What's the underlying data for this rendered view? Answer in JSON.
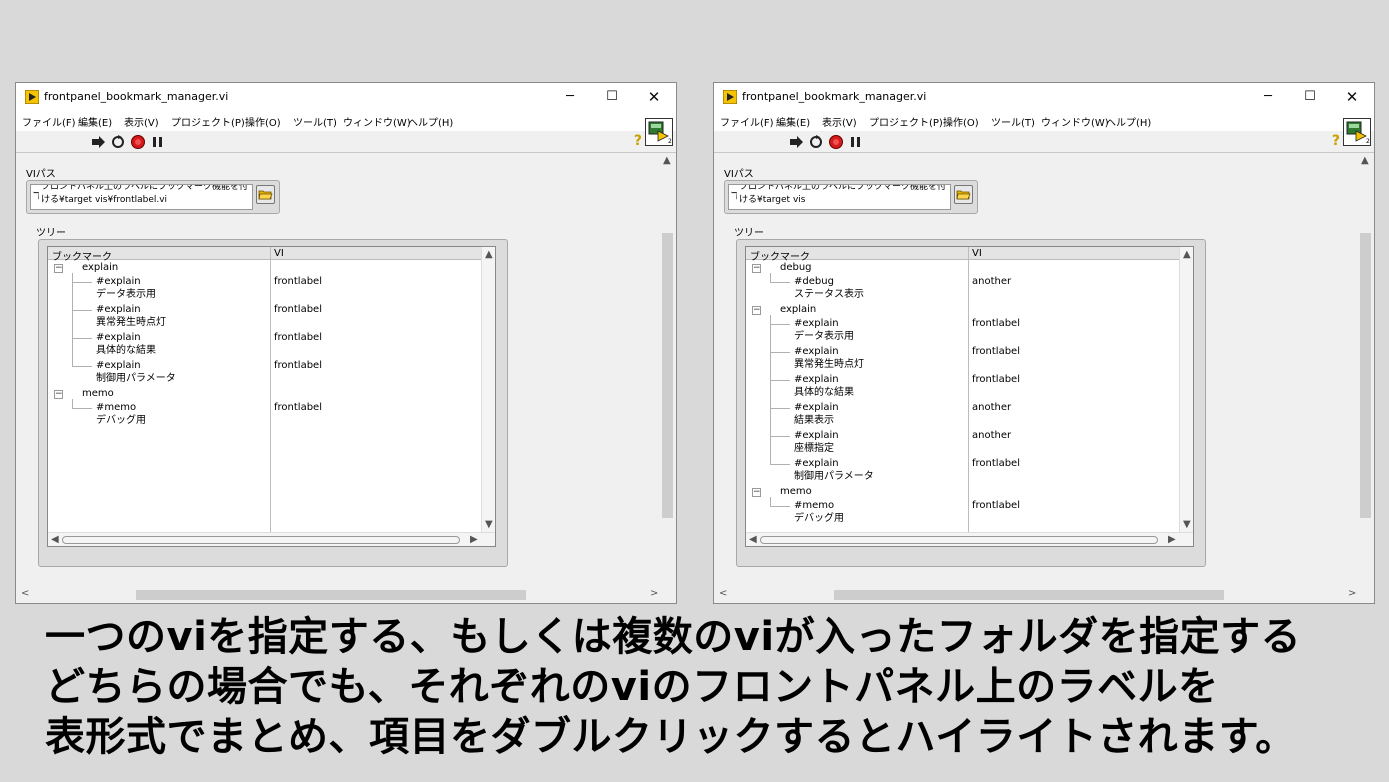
{
  "window_title": "frontpanel_bookmark_manager.vi",
  "window_controls": {
    "minimize": "─",
    "maximize": "☐",
    "close": "✕"
  },
  "menu": [
    "ファイル(F)",
    "編集(E)",
    "表示(V)",
    "プロジェクト(P)",
    "操作(O)",
    "ツール(T)",
    "ウィンドウ(W)",
    "ヘルプ(H)"
  ],
  "help_glyph": "?",
  "connector_badge": "2",
  "labels": {
    "vi_path": "VIパス",
    "tree": "ツリー",
    "stop_button": "停止ボタン",
    "stop": "停止"
  },
  "tree_columns": {
    "bookmark": "ブックマーク",
    "vi": "VI"
  },
  "colors": {
    "stop_red": "#ee1111",
    "labview_yellow": "#f5c400",
    "background": "#d9d9d9"
  },
  "left": {
    "path_prefix": "ℸ",
    "path_line1": "フロントパネル上のラベルにブックマーク機能を付",
    "path_line2": "ける¥target vis¥frontlabel.vi",
    "tree": [
      {
        "group": "explain",
        "items": [
          {
            "tag": "#explain",
            "label": "データ表示用",
            "vi": "frontlabel"
          },
          {
            "tag": "#explain",
            "label": "異常発生時点灯",
            "vi": "frontlabel"
          },
          {
            "tag": "#explain",
            "label": "具体的な結果",
            "vi": "frontlabel"
          },
          {
            "tag": "#explain",
            "label": "制御用パラメータ",
            "vi": "frontlabel"
          }
        ]
      },
      {
        "group": "memo",
        "items": [
          {
            "tag": "#memo",
            "label": "デバッグ用",
            "vi": "frontlabel"
          }
        ]
      }
    ]
  },
  "right": {
    "path_prefix": "ℸ",
    "path_line1": "フロントパネル上のラベルにブックマーク機能を付",
    "path_line2": "ける¥target vis",
    "tree": [
      {
        "group": "debug",
        "items": [
          {
            "tag": "#debug",
            "label": "ステータス表示",
            "vi": "another"
          }
        ]
      },
      {
        "group": "explain",
        "items": [
          {
            "tag": "#explain",
            "label": "データ表示用",
            "vi": "frontlabel"
          },
          {
            "tag": "#explain",
            "label": "異常発生時点灯",
            "vi": "frontlabel"
          },
          {
            "tag": "#explain",
            "label": "具体的な結果",
            "vi": "frontlabel"
          },
          {
            "tag": "#explain",
            "label": "結果表示",
            "vi": "another"
          },
          {
            "tag": "#explain",
            "label": "座標指定",
            "vi": "another"
          },
          {
            "tag": "#explain",
            "label": "制御用パラメータ",
            "vi": "frontlabel"
          }
        ]
      },
      {
        "group": "memo",
        "items": [
          {
            "tag": "#memo",
            "label": "デバッグ用",
            "vi": "frontlabel"
          }
        ]
      }
    ]
  },
  "caption": [
    "一つのviを指定する、もしくは複数のviが入ったフォルダを指定する",
    "どちらの場合でも、それぞれのviのフロントパネル上のラベルを",
    "表形式でまとめ、項目をダブルクリックするとハイライトされます。"
  ]
}
